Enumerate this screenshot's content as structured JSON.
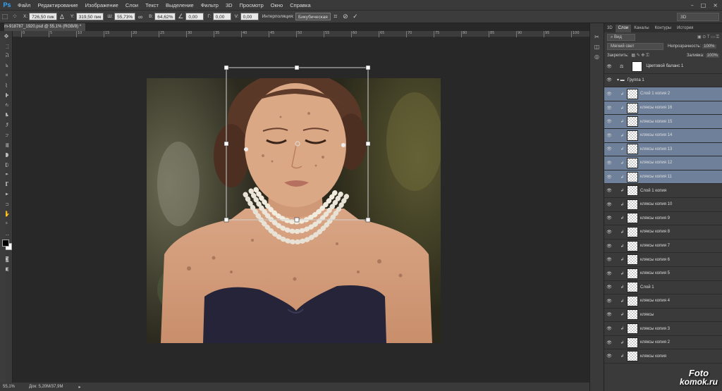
{
  "app": {
    "logo": "Ps"
  },
  "menu": [
    "Файл",
    "Редактирование",
    "Изображение",
    "Слои",
    "Текст",
    "Выделение",
    "Фильтр",
    "3D",
    "Просмотр",
    "Окно",
    "Справка"
  ],
  "window_controls": [
    "–",
    "□",
    "×"
  ],
  "options": {
    "x_label": "X:",
    "x_value": "726,50 пик",
    "y_label": "Y:",
    "y_value": "319,50 пик",
    "w_label": "Ш:",
    "w_value": "55,73%",
    "h_label": "В:",
    "h_value": "64,62%",
    "angle_value": "0,00",
    "hskew_label": "Г:",
    "hskew_value": "0,00",
    "vskew_label": "V:",
    "vskew_value": "0,00",
    "interp_label": "Интерполяция:",
    "interp_value": "Бикубическая",
    "workspace": "3D"
  },
  "document_tab": "m-918787_1920.psd @ 55,1% (RGB/8) *",
  "ruler_ticks": [
    "0",
    "5",
    "10",
    "15",
    "20",
    "25",
    "30",
    "35",
    "40",
    "45",
    "50",
    "55",
    "60",
    "65",
    "70",
    "75",
    "80",
    "85",
    "90",
    "95",
    "100"
  ],
  "status": {
    "zoom": "55,1%",
    "doc": "Док: 5,20M/37,9M"
  },
  "layers_panel": {
    "tabs": [
      "3D",
      "Слои",
      "Каналы",
      "Контуры",
      "История"
    ],
    "filter_label": "Вид",
    "blend_mode": "Мягкий свет",
    "opacity_label": "Непрозрачность:",
    "opacity_value": "100%",
    "lock_label": "Закрепить:",
    "fill_label": "Заливка:",
    "fill_value": "100%",
    "layers": [
      {
        "name": "Цветовой баланс 1",
        "type": "adjustment",
        "selected": false
      },
      {
        "name": "Группа 1",
        "type": "group",
        "selected": false
      },
      {
        "name": "Слой 1 копия 2",
        "type": "pixel",
        "selected": true,
        "clipped": true
      },
      {
        "name": "кляксы копия 16",
        "type": "pixel",
        "selected": true,
        "clipped": true
      },
      {
        "name": "кляксы копия 15",
        "type": "pixel",
        "selected": true,
        "clipped": true
      },
      {
        "name": "кляксы копия 14",
        "type": "pixel",
        "selected": true,
        "clipped": true
      },
      {
        "name": "кляксы копия 13",
        "type": "pixel",
        "selected": true,
        "clipped": true
      },
      {
        "name": "кляксы копия 12",
        "type": "pixel",
        "selected": true,
        "clipped": true
      },
      {
        "name": "кляксы копия 11",
        "type": "pixel",
        "selected": true,
        "clipped": true
      },
      {
        "name": "Слой 1 копия",
        "type": "pixel",
        "selected": false,
        "clipped": true
      },
      {
        "name": "кляксы копия 10",
        "type": "pixel",
        "selected": false,
        "clipped": true
      },
      {
        "name": "кляксы копия 9",
        "type": "pixel",
        "selected": false,
        "clipped": true
      },
      {
        "name": "кляксы копия 8",
        "type": "pixel",
        "selected": false,
        "clipped": true
      },
      {
        "name": "кляксы копия 7",
        "type": "pixel",
        "selected": false,
        "clipped": true
      },
      {
        "name": "кляксы копия 6",
        "type": "pixel",
        "selected": false,
        "clipped": true
      },
      {
        "name": "кляксы копия 5",
        "type": "pixel",
        "selected": false,
        "clipped": true
      },
      {
        "name": "Слой 1",
        "type": "pixel",
        "selected": false,
        "clipped": true
      },
      {
        "name": "кляксы копия 4",
        "type": "pixel",
        "selected": false,
        "clipped": true
      },
      {
        "name": "кляксы",
        "type": "pixel",
        "selected": false,
        "clipped": true
      },
      {
        "name": "кляксы копия 3",
        "type": "pixel",
        "selected": false,
        "clipped": true
      },
      {
        "name": "кляксы копия 2",
        "type": "pixel",
        "selected": false,
        "clipped": true
      },
      {
        "name": "кляксы копия",
        "type": "pixel",
        "selected": false,
        "clipped": true
      }
    ]
  },
  "watermark": {
    "line1": "Foto",
    "line2": "komok.ru"
  },
  "colors": {
    "accent": "#31a8ff",
    "selected_layer": "#6f819a"
  }
}
